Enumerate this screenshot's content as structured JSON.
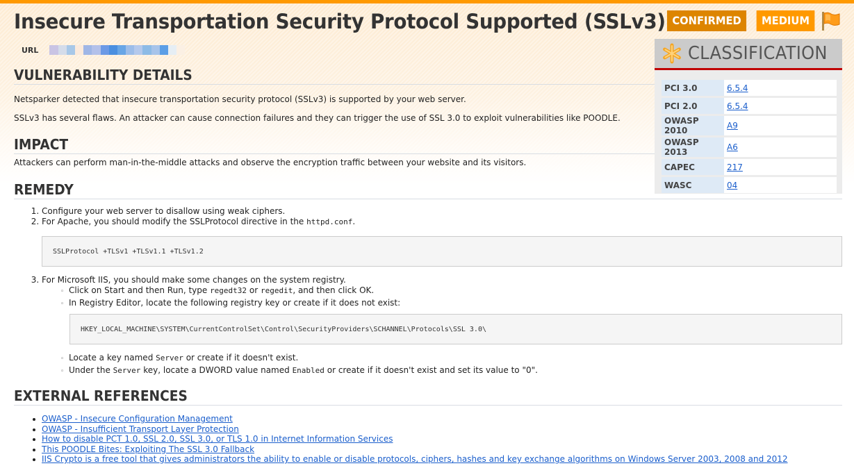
{
  "header": {
    "title": "Insecure Transportation Security Protocol Supported (SSLv3)",
    "url_label": "URL",
    "badges": {
      "confirmed": "CONFIRMED",
      "severity": "MEDIUM"
    },
    "flag_icon": "flag-icon"
  },
  "colors": {
    "accent_bar": "#ff9900",
    "confirmed_badge": "#dd8500",
    "medium_badge": "#ff9900",
    "classification_rule": "#c00000",
    "link": "#1a5ecc"
  },
  "classification": {
    "title": "CLASSIFICATION",
    "icon": "asterisk-icon",
    "rows": [
      {
        "key": "PCI 3.0",
        "value": "6.5.4"
      },
      {
        "key": "PCI 2.0",
        "value": "6.5.4"
      },
      {
        "key": "OWASP 2010",
        "value": "A9"
      },
      {
        "key": "OWASP 2013",
        "value": "A6"
      },
      {
        "key": "CAPEC",
        "value": "217"
      },
      {
        "key": "WASC",
        "value": "04"
      }
    ]
  },
  "vulnerability_details": {
    "heading": "VULNERABILITY DETAILS",
    "paragraphs": [
      "Netsparker detected that insecure transportation security protocol (SSLv3) is supported by your web server.",
      "SSLv3 has several flaws. An attacker can cause connection failures and they can trigger the use of SSL 3.0 to exploit vulnerabilities like POODLE."
    ]
  },
  "impact": {
    "heading": "IMPACT",
    "text": "Attackers can perform man-in-the-middle attacks and observe the encryption traffic between your website and its visitors."
  },
  "remedy": {
    "heading": "REMEDY",
    "step1": "Configure your web server to disallow using weak ciphers.",
    "step2_prefix": "For Apache, you should modify the SSLProtocol directive in the ",
    "step2_code": "httpd.conf",
    "step2_suffix": ".",
    "apache_code": "SSLProtocol +TLSv1 +TLSv1.1 +TLSv1.2",
    "step3": "For Microsoft IIS, you should make some changes on the system registry.",
    "sub1_a": "Click on Start and then Run, type ",
    "sub1_code1": "regedt32",
    "sub1_b": " or ",
    "sub1_code2": "regedit",
    "sub1_c": ", and then click OK.",
    "sub2": "In Registry Editor, locate the following registry key or create if it does not exist:",
    "registry_key": "HKEY_LOCAL_MACHINE\\SYSTEM\\CurrentControlSet\\Control\\SecurityProviders\\SCHANNEL\\Protocols\\SSL 3.0\\",
    "sub3_a": "Locate a key named ",
    "sub3_code": "Server",
    "sub3_b": " or create if it doesn't exist.",
    "sub4_a": "Under the ",
    "sub4_code1": "Server",
    "sub4_b": " key, locate a DWORD value named ",
    "sub4_code2": "Enabled",
    "sub4_c": " or create if it doesn't exist and set its value to \"0\"."
  },
  "external_references": {
    "heading": "EXTERNAL REFERENCES",
    "links": [
      "OWASP - Insecure Configuration Management",
      "OWASP - Insufficient Transport Layer Protection",
      "How to disable PCT 1.0, SSL 2.0, SSL 3.0, or TLS 1.0 in Internet Information Services",
      "This POODLE Bites: Exploiting The SSL 3.0 Fallback",
      "IIS Crypto is a free tool that gives administrators the ability to enable or disable protocols, ciphers, hashes and key exchange algorithms on Windows Server 2003, 2008 and 2012"
    ]
  }
}
